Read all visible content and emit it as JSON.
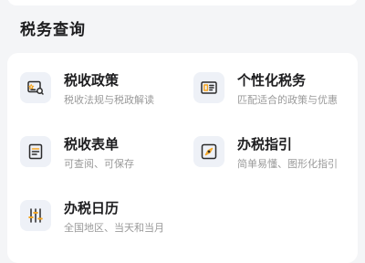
{
  "section": {
    "title": "税务查询"
  },
  "items": [
    {
      "title": "税收政策",
      "subtitle": "税收法规与税政解读",
      "icon": "policy-search-icon"
    },
    {
      "title": "个性化税务",
      "subtitle": "匹配适合的政策与优惠",
      "icon": "id-card-icon"
    },
    {
      "title": "税收表单",
      "subtitle": "可查阅、可保存",
      "icon": "form-document-icon"
    },
    {
      "title": "办税指引",
      "subtitle": "简单易懂、图形化指引",
      "icon": "compass-icon"
    },
    {
      "title": "办税日历",
      "subtitle": "全国地区、当天和当月",
      "icon": "sliders-icon"
    }
  ],
  "colors": {
    "icon_bg": "#eef1f7",
    "icon_stroke": "#2b2b2b",
    "accent": "#f5a623"
  }
}
